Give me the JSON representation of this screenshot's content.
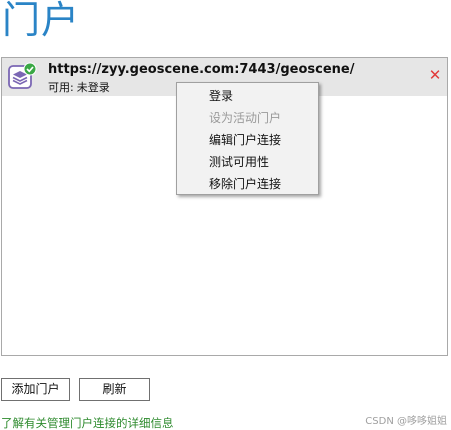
{
  "page": {
    "title": "门户"
  },
  "portal_list": {
    "items": [
      {
        "url": "https://zyy.geoscene.com:7443/geoscene/",
        "status_label": "可用:",
        "status_value": "未登录",
        "icon": "portal-connected-icon",
        "remove_icon": "close-icon"
      }
    ]
  },
  "context_menu": {
    "items": [
      {
        "label": "登录",
        "enabled": true
      },
      {
        "label": "设为活动门户",
        "enabled": false
      },
      {
        "label": "编辑门户连接",
        "enabled": true
      },
      {
        "label": "测试可用性",
        "enabled": true
      },
      {
        "label": "移除门户连接",
        "enabled": true
      }
    ]
  },
  "buttons": {
    "add_label": "添加门户",
    "refresh_label": "刷新"
  },
  "footer": {
    "help_link": "了解有关管理门户连接的详细信息",
    "watermark": "CSDN @哆哆姐姐"
  },
  "colors": {
    "title": "#2a84c6",
    "selected_row": "#e6e6e6",
    "remove": "#e23a3a",
    "link": "#2d8a2d",
    "check_badge": "#3aa845",
    "portal_icon": "#7b67b4"
  }
}
